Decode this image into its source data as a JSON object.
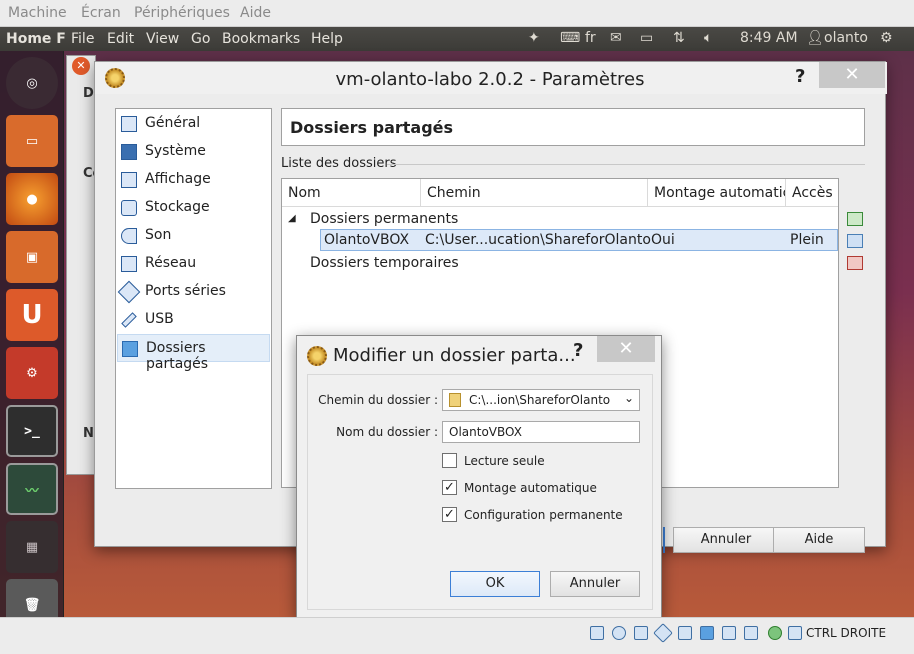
{
  "host_menu": {
    "items": [
      "Machine",
      "Écran",
      "Périphériques",
      "Aide"
    ]
  },
  "top_panel": {
    "app_name": "Home F",
    "menus": [
      "File",
      "Edit",
      "View",
      "Go",
      "Bookmarks",
      "Help"
    ],
    "keyboard_layout": "fr",
    "time": "8:49 AM",
    "user": "olanto"
  },
  "settings_dialog": {
    "title": "vm-olanto-labo 2.0.2 - Paramètres",
    "help_label": "?",
    "close_label": "✕",
    "nav_items": [
      {
        "label": "Général"
      },
      {
        "label": "Système"
      },
      {
        "label": "Affichage"
      },
      {
        "label": "Stockage"
      },
      {
        "label": "Son"
      },
      {
        "label": "Réseau"
      },
      {
        "label": "Ports séries"
      },
      {
        "label": "USB"
      },
      {
        "label": "Dossiers partagés"
      }
    ],
    "selected_nav": "Dossiers partagés",
    "page_title": "Dossiers partagés",
    "list_label": "Liste des dossiers",
    "columns": [
      "Nom",
      "Chemin",
      "Montage automatic",
      "Accès"
    ],
    "groups": [
      {
        "label": "Dossiers permanents",
        "rows": [
          {
            "name": "OlantoVBOX",
            "path": "C:\\User...ucation\\ShareforOlanto",
            "auto_mount": "Oui",
            "access": "Plein"
          }
        ]
      },
      {
        "label": "Dossiers temporaires",
        "rows": []
      }
    ],
    "buttons": {
      "cancel": "Annuler",
      "help": "Aide"
    }
  },
  "sub_dialog": {
    "title": "Modifier un dossier parta...",
    "help_label": "?",
    "close_label": "✕",
    "path_label": "Chemin du dossier :",
    "path_value": "C:\\...ion\\ShareforOlanto",
    "name_label": "Nom du dossier :",
    "name_value": "OlantoVBOX",
    "checkboxes": [
      {
        "label": "Lecture seule",
        "checked": false
      },
      {
        "label": "Montage automatique",
        "checked": true
      },
      {
        "label": "Configuration permanente",
        "checked": true
      }
    ],
    "ok_label": "OK",
    "cancel_label": "Annuler"
  },
  "statusbar": {
    "host_key": "CTRL DROITE"
  },
  "background_window": {
    "labels": [
      "D",
      "Co",
      "N"
    ]
  }
}
